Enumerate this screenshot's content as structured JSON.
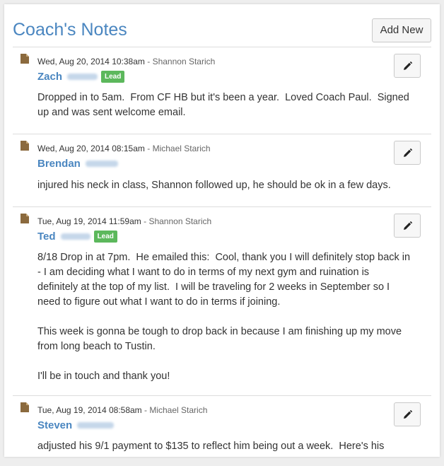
{
  "header": {
    "title": "Coach's Notes",
    "add_label": "Add New"
  },
  "notes": [
    {
      "meta": "Wed, Aug 20, 2014 10:38am",
      "author": " - Shannon Starich",
      "name": "Zach",
      "badge": "Lead",
      "body": "Dropped in to 5am.  From CF HB but it's been a year.  Loved Coach Paul.  Signed up and was sent welcome email."
    },
    {
      "meta": "Wed, Aug 20, 2014 08:15am",
      "author": " - Michael Starich",
      "name": "Brendan",
      "body": "injured his neck in class, Shannon followed up, he should be ok in a few days."
    },
    {
      "meta": "Tue, Aug 19, 2014 11:59am",
      "author": " - Shannon Starich",
      "name": "Ted",
      "badge": "Lead",
      "body": "8/18 Drop in at 7pm.  He emailed this:  Cool, thank you I will definitely stop back in - I am deciding what I want to do in terms of my next gym and ruination is definitely at the top of my list.  I will be traveling for 2 weeks in September so I need to figure out what I want to do in terms if joining.\n\nThis week is gonna be tough to drop back in because I am finishing up my move from long beach to Tustin.\n\nI'll be in touch and thank you!"
    },
    {
      "meta": "Tue, Aug 19, 2014 08:58am",
      "author": " - Michael Starich",
      "name": "Steven",
      "body": "adjusted his 9/1 payment to $135 to reflect him being out a week.  Here's his"
    }
  ],
  "colors": {
    "accent": "#4a86c0",
    "lead_badge": "#5cb85c",
    "note_icon": "#8b6a3e"
  },
  "icons": {
    "note": "note-icon",
    "edit": "pencil-icon"
  }
}
